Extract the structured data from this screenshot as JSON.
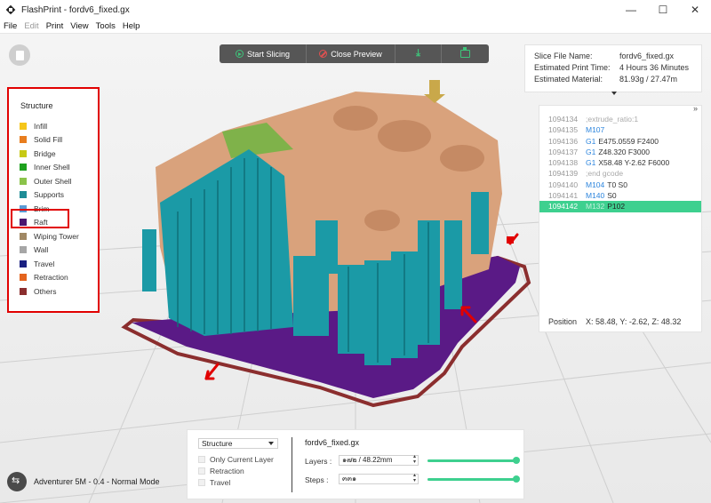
{
  "window": {
    "title": "FlashPrint - fordv6_fixed.gx",
    "minimize": "—",
    "maximize": "☐",
    "close": "✕"
  },
  "menu": [
    {
      "label": "File",
      "enabled": true
    },
    {
      "label": "Edit",
      "enabled": false
    },
    {
      "label": "Print",
      "enabled": true
    },
    {
      "label": "View",
      "enabled": true
    },
    {
      "label": "Tools",
      "enabled": true
    },
    {
      "label": "Help",
      "enabled": true
    }
  ],
  "toolbar": {
    "start_slicing": "Start Slicing",
    "close_preview": "Close Preview",
    "download_icon": "download-icon",
    "printer_icon": "print-icon",
    "accent_color": "#3ec47a"
  },
  "slice_info": {
    "file_label": "Slice File Name:",
    "file_value": "fordv6_fixed.gx",
    "time_label": "Estimated Print Time:",
    "time_value": "4 Hours 36 Minutes",
    "material_label": "Estimated Material:",
    "material_value": "81.93g / 27.47m"
  },
  "gcode": {
    "expand_label": "»",
    "lines": [
      {
        "num": "1094134",
        "cmd": "",
        "args": ";extrude_ratio:1",
        "comment": true,
        "active": false
      },
      {
        "num": "1094135",
        "cmd": "M107",
        "args": "",
        "comment": false,
        "active": false
      },
      {
        "num": "1094136",
        "cmd": "G1",
        "args": "E475.0559 F2400",
        "comment": false,
        "active": false
      },
      {
        "num": "1094137",
        "cmd": "G1",
        "args": "Z48.320 F3000",
        "comment": false,
        "active": false
      },
      {
        "num": "1094138",
        "cmd": "G1",
        "args": "X58.48 Y-2.62 F6000",
        "comment": false,
        "active": false
      },
      {
        "num": "1094139",
        "cmd": "",
        "args": ";end gcode",
        "comment": true,
        "active": false
      },
      {
        "num": "1094140",
        "cmd": "M104",
        "args": "T0 S0",
        "comment": false,
        "active": false
      },
      {
        "num": "1094141",
        "cmd": "M140",
        "args": "S0",
        "comment": false,
        "active": false
      },
      {
        "num": "1094142",
        "cmd": "M132",
        "args": "P102",
        "comment": false,
        "active": true
      }
    ],
    "position_label": "Position",
    "position_value": "X: 58.48, Y: -2.62, Z: 48.32"
  },
  "legend": {
    "title": "Structure",
    "items": [
      {
        "label": "Infill",
        "color": "#f5c61a"
      },
      {
        "label": "Solid Fill",
        "color": "#e87d1e"
      },
      {
        "label": "Bridge",
        "color": "#c7c915"
      },
      {
        "label": "Inner Shell",
        "color": "#1ea11e"
      },
      {
        "label": "Outer Shell",
        "color": "#8bc34a"
      },
      {
        "label": "Supports",
        "color": "#1e8c96"
      },
      {
        "label": "Brim",
        "color": "#5b9bd5"
      },
      {
        "label": "Raft",
        "color": "#4b1670"
      },
      {
        "label": "Wiping Tower",
        "color": "#a08864"
      },
      {
        "label": "Wall",
        "color": "#a6a6a6"
      },
      {
        "label": "Travel",
        "color": "#1a2080"
      },
      {
        "label": "Retraction",
        "color": "#e4641e"
      },
      {
        "label": "Others",
        "color": "#8b2e2e"
      }
    ]
  },
  "controls": {
    "view_select": "Structure",
    "only_current_layer": "Only Current Layer",
    "retraction": "Retraction",
    "travel": "Travel",
    "file_name": "fordv6_fixed.gx",
    "layers_label": "Layers :",
    "layers_value": "๑๗๒ / 48.22mm",
    "steps_label": "Steps :",
    "steps_value": "๓๓๑",
    "layers_level": 1.0,
    "steps_level": 1.0
  },
  "printer": {
    "status": "Adventurer 5M - 0.4 - Normal Mode"
  },
  "scene_colors": {
    "model": "#d9a27c",
    "supports": "#1b9aa6",
    "raft": "#5a1a86",
    "brim": "#8b2e2e",
    "gold": "#c9a84a",
    "annotation": "#e10000"
  }
}
